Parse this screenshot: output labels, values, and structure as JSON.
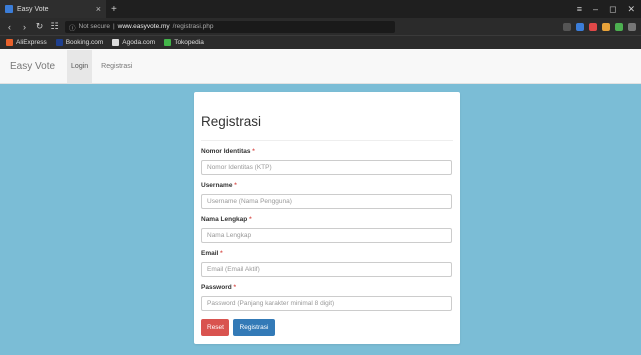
{
  "browser": {
    "tab_title": "Easy Vote",
    "tab_close": "×",
    "new_tab": "+",
    "url_security": "Not secure",
    "url_host": "www.easyvote.my",
    "url_path": "/registrasi.php",
    "bookmarks": [
      "AliExpress",
      "Booking.com",
      "Agoda.com",
      "Tokopedia"
    ]
  },
  "navbar": {
    "brand": "Easy Vote",
    "links": [
      "Login",
      "Registrasi"
    ]
  },
  "form": {
    "title": "Registrasi",
    "fields": [
      {
        "label": "Nomor Identitas",
        "placeholder": "Nomor Identitas (KTP)"
      },
      {
        "label": "Username",
        "placeholder": "Username (Nama Pengguna)"
      },
      {
        "label": "Nama Lengkap",
        "placeholder": "Nama Lengkap"
      },
      {
        "label": "Email",
        "placeholder": "Email (Email Aktif)"
      },
      {
        "label": "Password",
        "placeholder": "Password (Panjang karakter minimal 8 digit)"
      }
    ],
    "required_mark": "*",
    "reset_label": "Reset",
    "submit_label": "Registrasi"
  },
  "colors": {
    "page_bg": "#7bbdd6",
    "reset": "#d9534f",
    "submit": "#337ab7"
  }
}
